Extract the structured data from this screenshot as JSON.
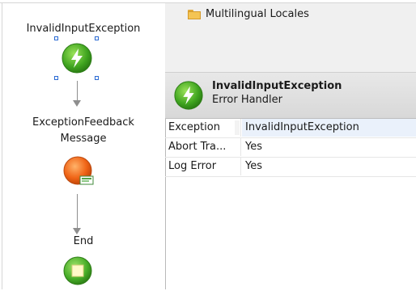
{
  "flow": {
    "start_label": "InvalidInputException",
    "feedback_label_line1": "ExceptionFeedback",
    "feedback_label_line2": "Message",
    "end_label": "End",
    "icons": [
      "exception-handler-icon",
      "feedback-message-icon",
      "end-icon"
    ]
  },
  "tree": {
    "item_label": "Multilingual Locales",
    "item_icon": "folder-icon"
  },
  "properties": {
    "title": "InvalidInputException",
    "subtitle": "Error Handler",
    "rows": [
      {
        "name": "Exception",
        "value": "InvalidInputException"
      },
      {
        "name": "Abort Tra...",
        "value": "Yes"
      },
      {
        "name": "Log Error",
        "value": "Yes"
      }
    ]
  },
  "colors": {
    "handler_green": "#49b02b",
    "feedback_orange": "#f26a1b",
    "end_green": "#4ab52b",
    "selection_blue": "#2a6ad3",
    "row_highlight": "#eaf1fb"
  }
}
